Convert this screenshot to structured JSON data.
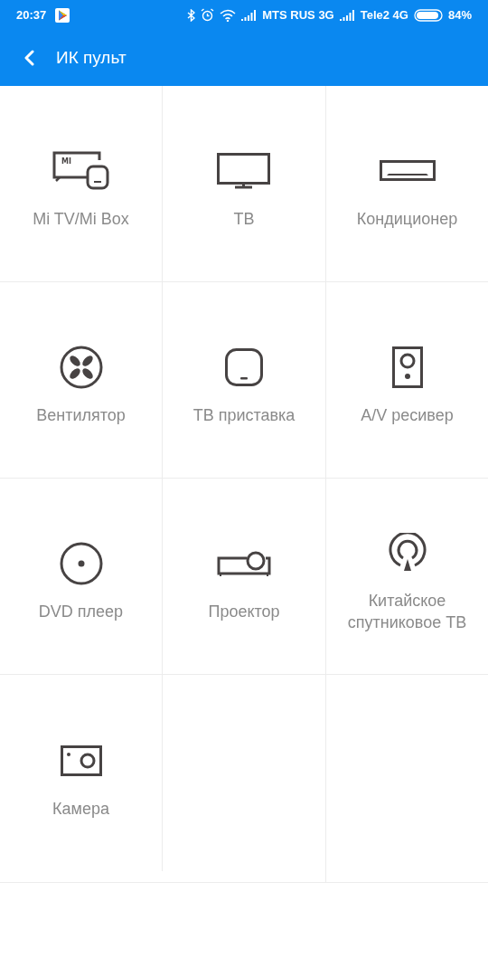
{
  "status_bar": {
    "time": "20:37",
    "carrier_1": "MTS RUS 3G",
    "carrier_2": "Tele2 4G",
    "battery": "84%"
  },
  "toolbar": {
    "title": "ИК пульт"
  },
  "devices": [
    {
      "kind": "mitv",
      "label": "Mi TV/Mi Box",
      "logo": "MI"
    },
    {
      "kind": "tv",
      "label": "ТВ"
    },
    {
      "kind": "ac",
      "label": "Кондиционер"
    },
    {
      "kind": "fan",
      "label": "Вентилятор"
    },
    {
      "kind": "box",
      "label": "ТВ приставка"
    },
    {
      "kind": "speaker",
      "label": "A/V ресивер"
    },
    {
      "kind": "disc",
      "label": "DVD плеер"
    },
    {
      "kind": "projector",
      "label": "Проектор"
    },
    {
      "kind": "satellite",
      "label": "Китайское спутниковое ТВ"
    },
    {
      "kind": "camera",
      "label": "Камера"
    }
  ]
}
